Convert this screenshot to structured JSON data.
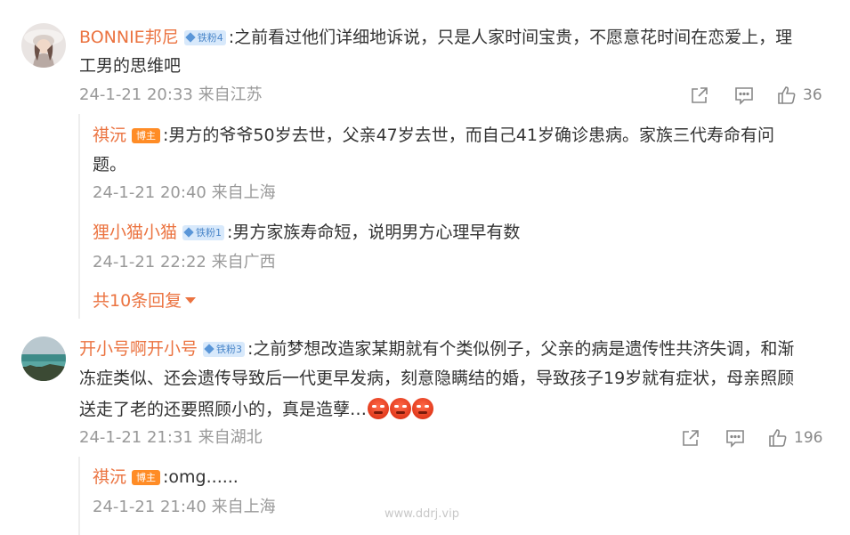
{
  "comments": [
    {
      "username": "BONNIE邦尼",
      "badge": "铁粉4",
      "text_line1": ":之前看过他们详细地诉说，只是人家时间宝贵，不愿意花时间在恋爱上，理",
      "text_line2": "工男的思维吧",
      "timestamp": "24-1-21 20:33 来自江苏",
      "like_count": "36",
      "replies": [
        {
          "username": "祺沅",
          "badge": "博主",
          "text_line1": ":男方的爷爷50岁去世，父亲47岁去世，而自己41岁确诊患病。家族三代寿命有问",
          "text_line2": "题。",
          "timestamp": "24-1-21 20:40 来自上海"
        },
        {
          "username": "狸小猫小猫",
          "badge": "铁粉1",
          "text_line1": ":男方家族寿命短，说明男方心理早有数",
          "timestamp": "24-1-21 22:22 来自广西"
        }
      ],
      "more_replies": "共10条回复"
    },
    {
      "username": "开小号啊开小号",
      "badge": "铁粉3",
      "text_line1": ":之前梦想改造家某期就有个类似例子，父亲的病是遗传性共济失调，和渐",
      "text_line2": "冻症类似、还会遗传导致后一代更早发病，刻意隐瞒结的婚，导致孩子19岁就有症状，母亲照顾",
      "text_line3": "送走了老的还要照顾小的，真是造孽…",
      "emojis": [
        "angry-emoji",
        "angry-emoji",
        "angry-emoji"
      ],
      "timestamp": "24-1-21 21:31 来自湖北",
      "like_count": "196",
      "replies": [
        {
          "username": "祺沅",
          "badge": "博主",
          "text_line1": ":omg......",
          "timestamp": "24-1-21 21:40 来自上海"
        }
      ]
    }
  ],
  "watermark": "www.ddrj.vip",
  "colors": {
    "username": "#eb7340",
    "meta": "#999999",
    "fan_badge_bg": "#d8e9fb",
    "host_badge_bg": "#ff8c26"
  }
}
